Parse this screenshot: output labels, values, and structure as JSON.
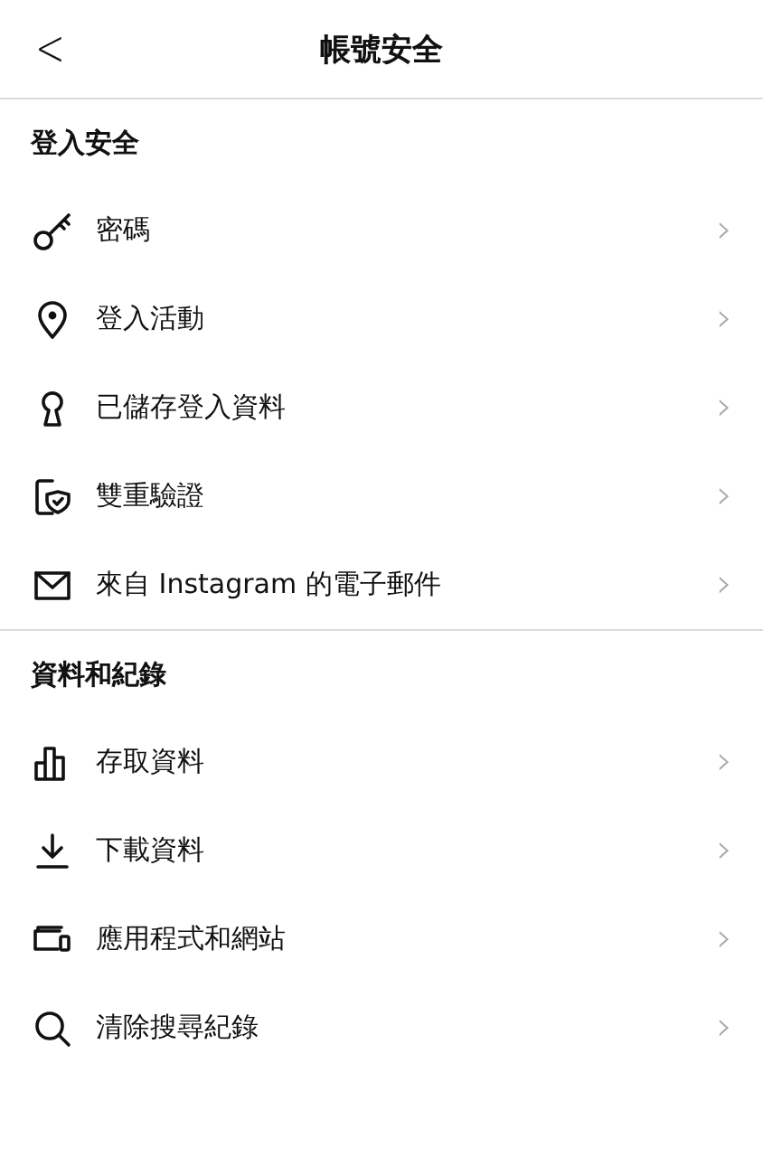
{
  "header": {
    "back": "<",
    "title": "帳號安全"
  },
  "sections": [
    {
      "title": "登入安全",
      "items": [
        {
          "label": "密碼",
          "chevron": "›"
        },
        {
          "label": "登入活動",
          "chevron": "›"
        },
        {
          "label": "已儲存登入資料",
          "chevron": "›"
        },
        {
          "label": "雙重驗證",
          "chevron": "›"
        },
        {
          "label": "來自 Instagram 的電子郵件",
          "chevron": "›"
        }
      ]
    },
    {
      "title": "資料和紀錄",
      "items": [
        {
          "label": "存取資料",
          "chevron": "›"
        },
        {
          "label": "下載資料",
          "chevron": "›"
        },
        {
          "label": "應用程式和網站",
          "chevron": "›"
        },
        {
          "label": "清除搜尋紀錄",
          "chevron": "›"
        }
      ]
    }
  ]
}
